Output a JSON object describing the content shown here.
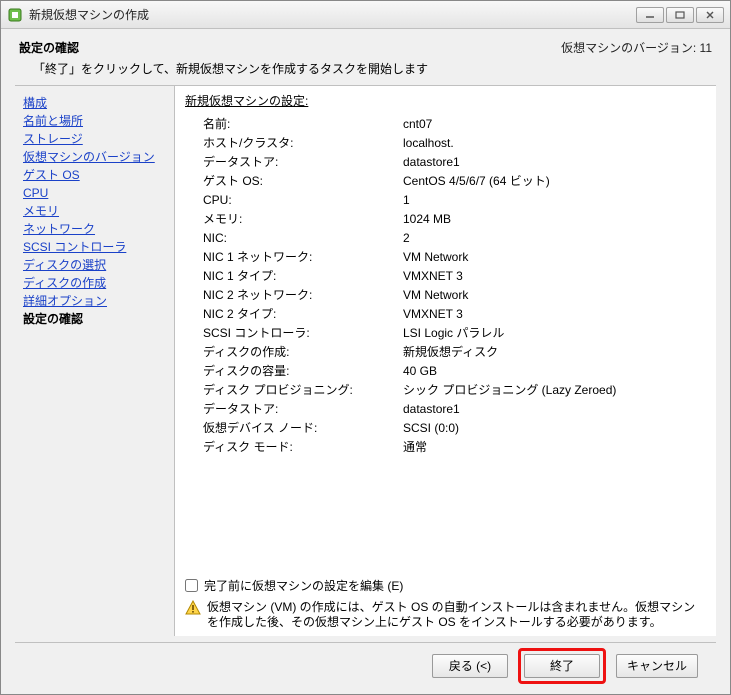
{
  "window": {
    "title": "新規仮想マシンの作成"
  },
  "header": {
    "title": "設定の確認",
    "version": "仮想マシンのバージョン: 11",
    "subtitle": "「終了」をクリックして、新規仮想マシンを作成するタスクを開始します"
  },
  "sidebar": {
    "items": [
      "構成",
      "名前と場所",
      "ストレージ",
      "仮想マシンのバージョン",
      "ゲスト OS",
      "CPU",
      "メモリ",
      "ネットワーク",
      "SCSI コントローラ",
      "ディスクの選択",
      "ディスクの作成",
      "詳細オプション"
    ],
    "current": "設定の確認"
  },
  "settings": {
    "title": "新規仮想マシンの設定:",
    "rows": [
      {
        "label": "名前:",
        "value": "cnt07"
      },
      {
        "label": "ホスト/クラスタ:",
        "value": "localhost."
      },
      {
        "label": "データストア:",
        "value": "datastore1"
      },
      {
        "label": "ゲスト OS:",
        "value": "CentOS 4/5/6/7 (64 ビット)"
      },
      {
        "label": "CPU:",
        "value": "1"
      },
      {
        "label": "メモリ:",
        "value": "1024 MB"
      },
      {
        "label": "NIC:",
        "value": "2"
      },
      {
        "label": "NIC 1 ネットワーク:",
        "value": "VM Network"
      },
      {
        "label": "NIC 1 タイプ:",
        "value": "VMXNET 3"
      },
      {
        "label": "NIC 2 ネットワーク:",
        "value": "VM Network"
      },
      {
        "label": "NIC 2 タイプ:",
        "value": "VMXNET 3"
      },
      {
        "label": "SCSI コントローラ:",
        "value": "LSI Logic パラレル"
      },
      {
        "label": "ディスクの作成:",
        "value": "新規仮想ディスク"
      },
      {
        "label": "ディスクの容量:",
        "value": "40 GB"
      },
      {
        "label": "ディスク プロビジョニング:",
        "value": "シック プロビジョニング (Lazy Zeroed)"
      },
      {
        "label": "データストア:",
        "value": "datastore1"
      },
      {
        "label": "仮想デバイス ノード:",
        "value": "SCSI (0:0)"
      },
      {
        "label": "ディスク モード:",
        "value": "通常"
      }
    ]
  },
  "editCheckbox": {
    "label": "完了前に仮想マシンの設定を編集 (E)"
  },
  "warning": {
    "text": "仮想マシン (VM) の作成には、ゲスト OS の自動インストールは含まれません。仮想マシンを作成した後、その仮想マシン上にゲスト OS をインストールする必要があります。"
  },
  "buttons": {
    "back": "戻る (<)",
    "finish": "終了",
    "cancel": "キャンセル"
  }
}
